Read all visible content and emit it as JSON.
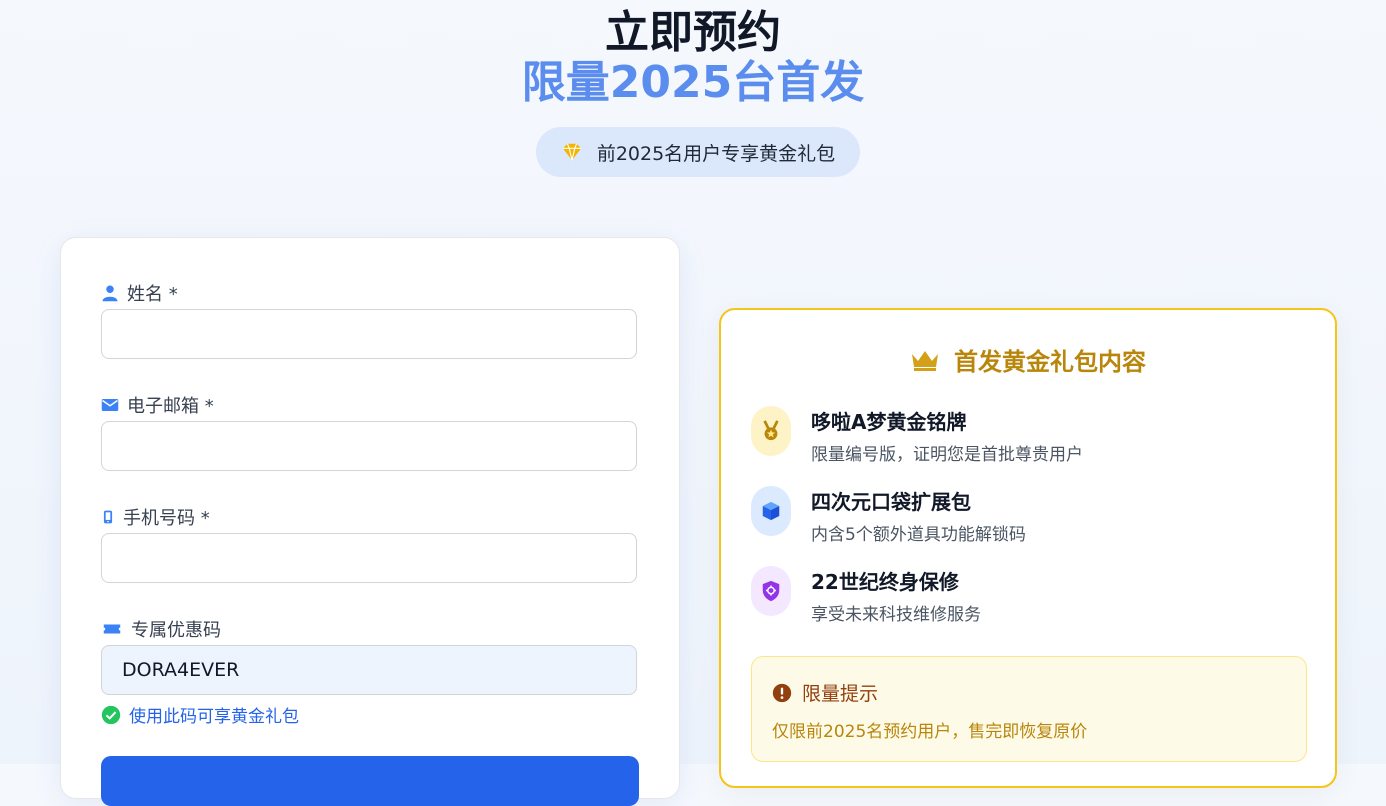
{
  "header": {
    "title": "立即预约",
    "subtitle": "限量2025台首发",
    "promo_pill": "前2025名用户专享黄金礼包"
  },
  "form": {
    "name_label": "姓名 *",
    "email_label": "电子邮箱 *",
    "phone_label": "手机号码 *",
    "coupon_label": "专属优惠码",
    "coupon_value": "DORA4EVER",
    "coupon_hint": "使用此码可享黄金礼包"
  },
  "gift": {
    "title": "首发黄金礼包内容",
    "items": [
      {
        "name": "哆啦A梦黄金铭牌",
        "desc": "限量编号版，证明您是首批尊贵用户",
        "icon": "medal-icon"
      },
      {
        "name": "四次元口袋扩展包",
        "desc": "内含5个额外道具功能解锁码",
        "icon": "box-icon"
      },
      {
        "name": "22世纪终身保修",
        "desc": "享受未来科技维修服务",
        "icon": "shield-icon"
      }
    ],
    "notice_title": "限量提示",
    "notice_text": "仅限前2025名预约用户，售完即恢复原价"
  },
  "colors": {
    "accent_blue": "#2563eb",
    "gold": "#b8860b",
    "gold_border": "#f5c518"
  }
}
